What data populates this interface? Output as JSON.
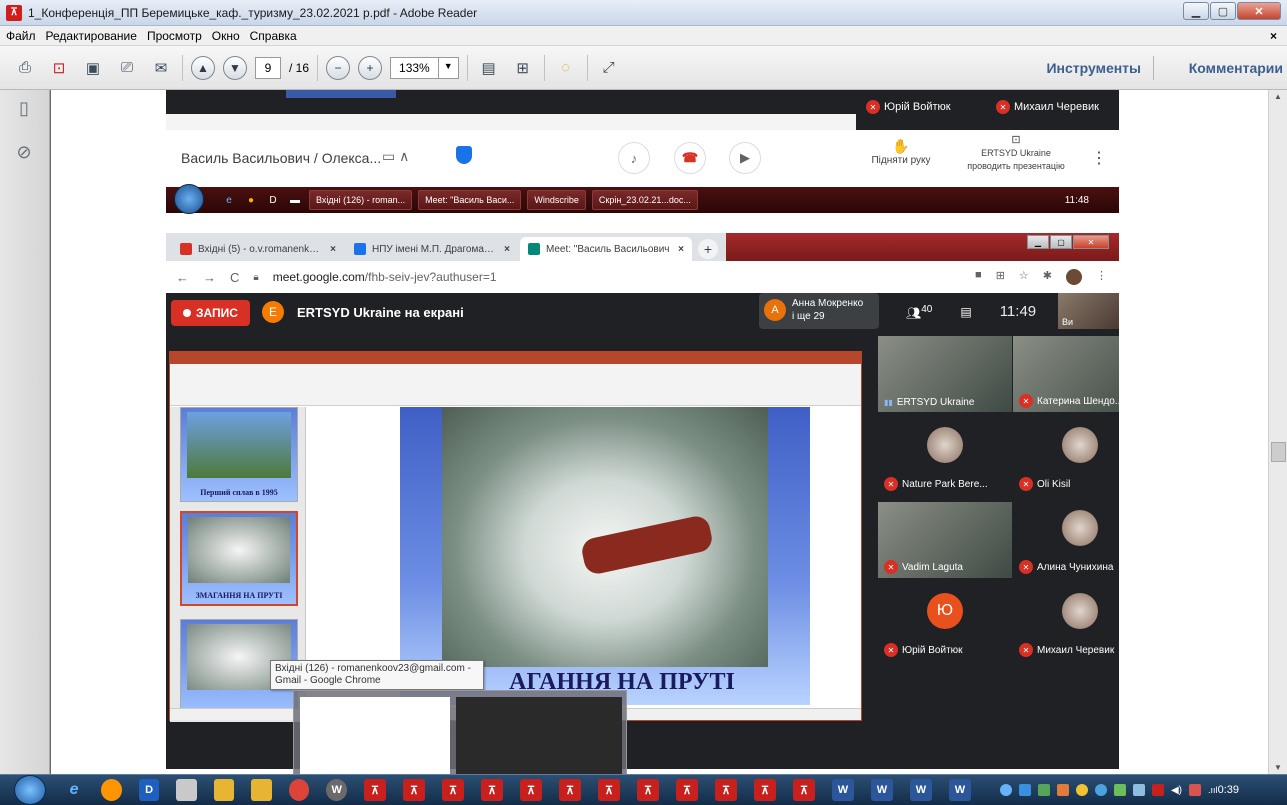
{
  "window": {
    "title": "1_Конференція_ПП Беремицьке_каф._туризму_23.02.2021 р.pdf - Adobe Reader",
    "app_icon": "pdf-icon"
  },
  "menu": {
    "items": [
      "Файл",
      "Редактирование",
      "Просмотр",
      "Окно",
      "Справка"
    ],
    "close_glyph": "×"
  },
  "toolbar": {
    "page_current": "9",
    "page_total": "/ 16",
    "zoom": "133%",
    "tools_label": "Инструменты",
    "comments_label": "Комментарии"
  },
  "meet_top": {
    "participants": [
      {
        "name": "Юрій Войтюк",
        "muted": true
      },
      {
        "name": "Михаил Черевик",
        "muted": true
      }
    ]
  },
  "meet_bar": {
    "meeting_name": "Василь Васильович / Олекса...",
    "raise_hand": "Підняти руку",
    "presenter": "ERTSYD Ukraine",
    "presenting": "проводить презентацію"
  },
  "taskbar_embedded": {
    "tasks": [
      "Вхідні (126) - roman...",
      "Meet: \"Василь Васи...",
      "Windscribe",
      "Скрін_23.02.21...doc..."
    ],
    "clock": "11:48"
  },
  "browser": {
    "tabs": [
      {
        "label": "Вхідні (5) - o.v.romanenko@npu...",
        "color": "#d93025"
      },
      {
        "label": "НПУ імені М.П. Драгоманова -",
        "color": "#1a73e8"
      },
      {
        "label": "Meet: \"Василь Васильович",
        "color": "#00897b"
      }
    ],
    "url_host": "meet.google.com",
    "url_path": "/fhb-seiv-jev?authuser=1"
  },
  "meet": {
    "rec_label": "ЗАПИС",
    "presenter_initial": "E",
    "presenting_label": "ERTSYD Ukraine на екрані",
    "popup_initial": "A",
    "popup_name": "Анна Мокренко",
    "popup_more": "і ще 29",
    "participant_count": "40",
    "clock": "11:49",
    "self_label": "Ви"
  },
  "slide": {
    "title": "ЗМАГАННЯ НА ПРУТІ",
    "visible_title": "АГАННЯ НА ПРУТІ",
    "thumb1_caption": "Перший сплав в 1995",
    "thumb2_caption": "ЗМАГАННЯ НА ПРУТІ"
  },
  "participants": [
    {
      "name": "ERTSYD Ukraine",
      "muted": false,
      "kind": "video"
    },
    {
      "name": "Катерина Шендо...",
      "muted": true,
      "kind": "video"
    },
    {
      "name": "Nature Park Bere...",
      "muted": true,
      "kind": "avatar"
    },
    {
      "name": "Oli Kisil",
      "muted": true,
      "kind": "avatar"
    },
    {
      "name": "Vadim Laguta",
      "muted": true,
      "kind": "video"
    },
    {
      "name": "Алина Чунихина",
      "muted": true,
      "kind": "avatar"
    },
    {
      "name": "Юрій Войтюк",
      "muted": true,
      "kind": "initial",
      "initial": "Ю"
    },
    {
      "name": "Михаил Черевик",
      "muted": true,
      "kind": "avatar"
    }
  ],
  "tooltip": {
    "text": "Вхідні (126) - romanenkoov23@gmail.com - Gmail - Google Chrome"
  },
  "wintaskbar": {
    "clock": "0:39",
    "pdf_count": 12,
    "word_count": 4
  },
  "colors": {
    "meet_bg": "#202124",
    "record_red": "#d93025",
    "adobe_red": "#c8201d",
    "ppt_accent": "#b7472a"
  }
}
